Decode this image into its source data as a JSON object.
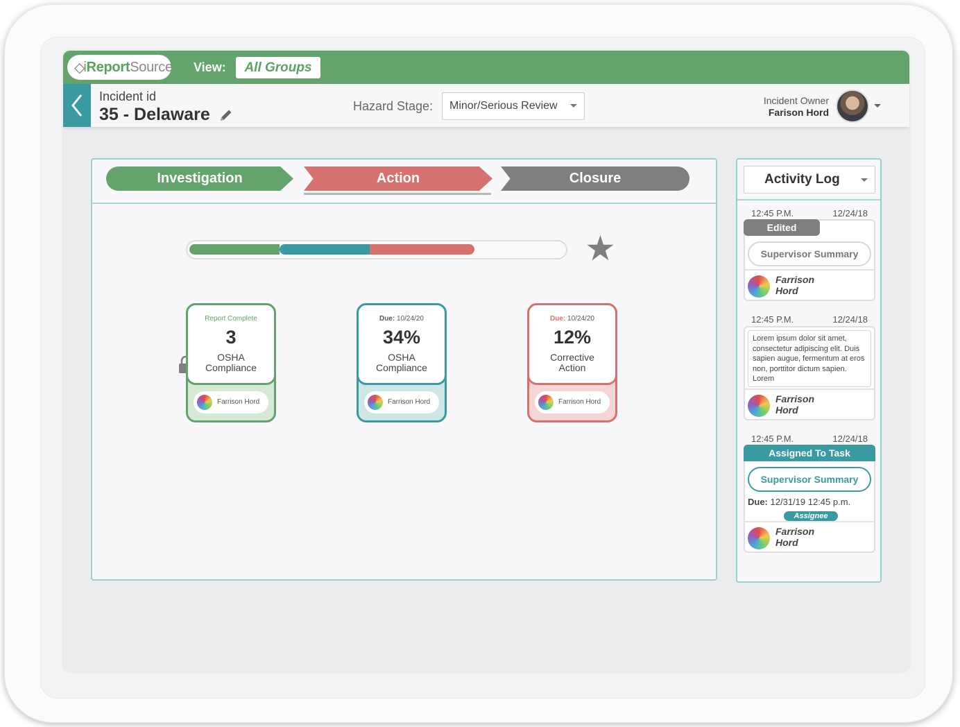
{
  "app": {
    "logo": {
      "prefix": "i",
      "brand_bold": "Report",
      "brand_light": "Source"
    },
    "view_label": "View:",
    "view_value": "All Groups"
  },
  "incident": {
    "label": "Incident id",
    "title": "35 - Delaware",
    "hazard_label": "Hazard Stage:",
    "hazard_value": "Minor/Serious Review",
    "owner_label": "Incident Owner",
    "owner_name": "Farison Hord"
  },
  "stages": {
    "investigation": "Investigation",
    "action": "Action",
    "closure": "Closure",
    "active": "Action"
  },
  "progress": {
    "segments": [
      {
        "name": "investigation",
        "fraction": 0.24,
        "color": "#65a36c"
      },
      {
        "name": "action-teal",
        "fraction": 0.24,
        "color": "#3a9aa2"
      },
      {
        "name": "action-red",
        "fraction": 0.28,
        "color": "#d5716f"
      }
    ]
  },
  "cards": [
    {
      "meta_prefix": "",
      "meta": "Report Complete",
      "value": "3",
      "label_line1": "OSHA",
      "label_line2": "Compliance",
      "user": "Farrison Hord",
      "locked": true
    },
    {
      "meta_prefix": "Due:",
      "meta": "10/24/20",
      "value": "34%",
      "label_line1": "OSHA",
      "label_line2": "Compliance",
      "user": "Farrison Hord",
      "locked": false
    },
    {
      "meta_prefix": "Due:",
      "meta": "10/24/20",
      "value": "12%",
      "label_line1": "Corrective",
      "label_line2": "Action",
      "user": "Farrison Hord",
      "locked": false
    }
  ],
  "activity": {
    "title": "Activity Log",
    "entries": [
      {
        "time": "12:45 P.M.",
        "date": "12/24/18",
        "tag": "Edited",
        "pill": "Supervisor Summary",
        "user_first": "Farrison",
        "user_last": "Hord"
      },
      {
        "time": "12:45 P.M.",
        "date": "12/24/18",
        "text": "Lorem ipsum dolor sit amet, consectetur adipiscing elit. Duis sapien augue, fermentum at eros non, porttitor dictum sapien. Lorem",
        "user_first": "Farrison",
        "user_last": "Hord"
      },
      {
        "time": "12:45 P.M.",
        "date": "12/24/18",
        "tag": "Assigned To Task",
        "pill": "Supervisor Summary",
        "due_label": "Due:",
        "due_value": "12/31/19  12:45 p.m.",
        "badge": "Assignee",
        "user_first": "Farrison",
        "user_last": "Hord"
      }
    ]
  },
  "colors": {
    "green": "#65a36c",
    "teal": "#3a9aa2",
    "red": "#d5716f",
    "gray": "#7f7f80"
  }
}
